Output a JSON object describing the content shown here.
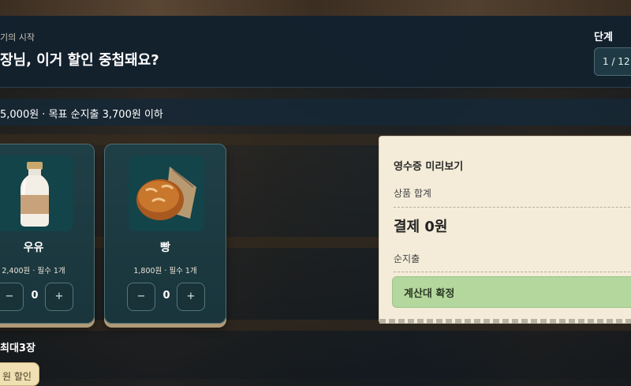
{
  "header": {
    "chapter": "기의 시작",
    "title": "장님, 이거 할인 중첩돼요?",
    "step_label": "단계",
    "step_value": "1 / 12"
  },
  "budget": {
    "text": "5,000원 · 목표 순지출 3,700원 이하"
  },
  "products": [
    {
      "name": "우유",
      "meta": "2,400원 · 필수 1개",
      "qty": "0",
      "minus": "−",
      "plus": "+",
      "icon": "milk-bottle-icon"
    },
    {
      "name": "빵",
      "meta": "1,800원 · 필수 1개",
      "qty": "0",
      "minus": "−",
      "plus": "+",
      "icon": "bread-icon"
    }
  ],
  "receipt": {
    "title": "영수증 미리보기",
    "subtotal_label": "상품 합계",
    "total": "결제 0원",
    "net_label": "순지출",
    "confirm_label": "계산대 확정"
  },
  "coupons": {
    "title": "최대3장",
    "chip_label": "원 할인"
  },
  "colors": {
    "panel": "#12212e",
    "card": "#1f3f46",
    "receipt": "#f4ecd9",
    "confirm": "#b4d79e",
    "coupon": "#f0dfb2"
  }
}
